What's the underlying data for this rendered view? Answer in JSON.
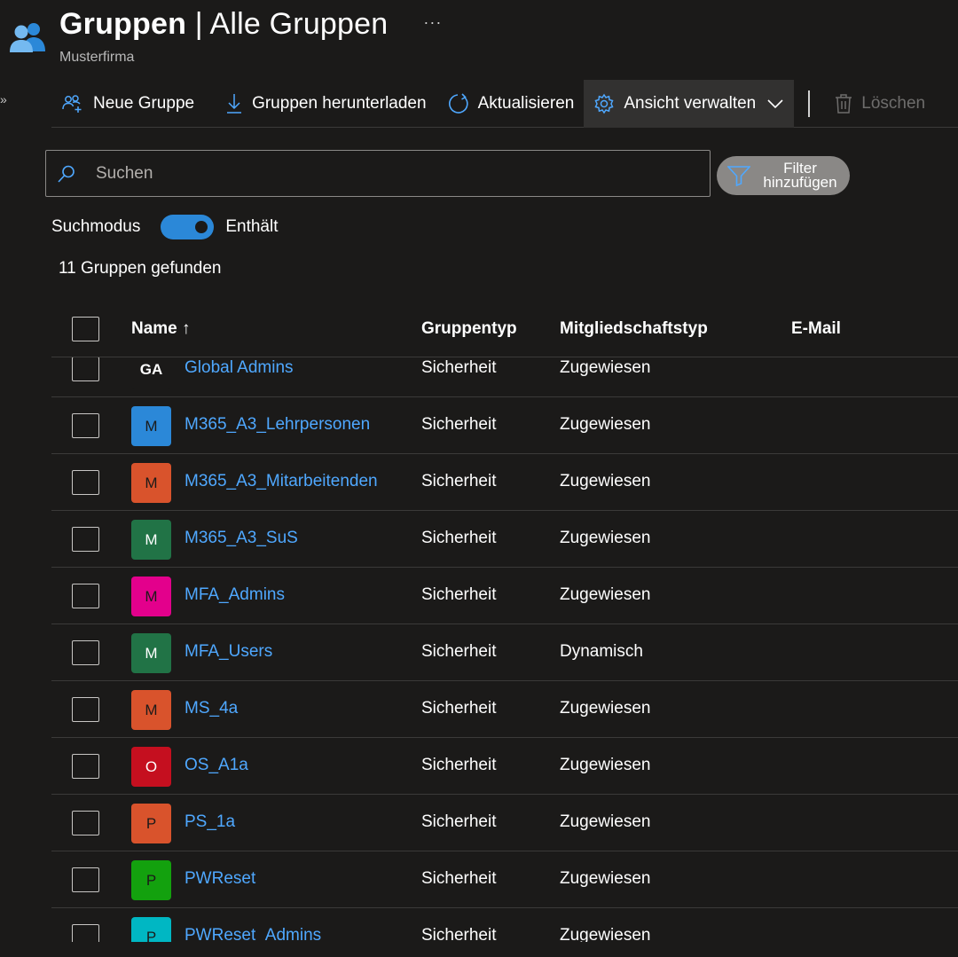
{
  "header": {
    "title_bold": "Gruppen",
    "title_rest": " | Alle Gruppen",
    "more": "···",
    "subtitle": "Musterfirma",
    "expand": "»"
  },
  "toolbar": {
    "new_group": "Neue Gruppe",
    "download": "Gruppen herunterladen",
    "refresh": "Aktualisieren",
    "manage_view": "Ansicht verwalten",
    "delete": "Löschen"
  },
  "search": {
    "placeholder": "Suchen",
    "value": ""
  },
  "filter": {
    "label": "Filter hinzufügen"
  },
  "search_mode": {
    "label": "Suchmodus",
    "value": "Enthält",
    "on": true
  },
  "result_count": "11 Gruppen gefunden",
  "table": {
    "columns": {
      "name": "Name ↑",
      "type": "Gruppentyp",
      "membership": "Mitgliedschaftstyp",
      "email": "E-Mail"
    },
    "rows": [
      {
        "initials": "GA",
        "color": "#1b1a19",
        "name": "Global Admins",
        "type": "Sicherheit",
        "membership": "Zugewiesen"
      },
      {
        "initials": "M",
        "color": "#2b88d8",
        "name": "M365_A3_Lehrpersonen",
        "type": "Sicherheit",
        "membership": "Zugewiesen"
      },
      {
        "initials": "M",
        "color": "#d9532c",
        "name": "M365_A3_Mitarbeitenden",
        "type": "Sicherheit",
        "membership": "Zugewiesen"
      },
      {
        "initials": "M",
        "color": "#217346",
        "name": "M365_A3_SuS",
        "type": "Sicherheit",
        "membership": "Zugewiesen"
      },
      {
        "initials": "M",
        "color": "#e3008c",
        "name": "MFA_Admins",
        "type": "Sicherheit",
        "membership": "Zugewiesen"
      },
      {
        "initials": "M",
        "color": "#217346",
        "name": "MFA_Users",
        "type": "Sicherheit",
        "membership": "Dynamisch"
      },
      {
        "initials": "M",
        "color": "#d9532c",
        "name": "MS_4a",
        "type": "Sicherheit",
        "membership": "Zugewiesen"
      },
      {
        "initials": "O",
        "color": "#c50f1f",
        "name": "OS_A1a",
        "type": "Sicherheit",
        "membership": "Zugewiesen"
      },
      {
        "initials": "P",
        "color": "#d9532c",
        "name": "PS_1a",
        "type": "Sicherheit",
        "membership": "Zugewiesen"
      },
      {
        "initials": "P",
        "color": "#13a10e",
        "name": "PWReset",
        "type": "Sicherheit",
        "membership": "Zugewiesen"
      },
      {
        "initials": "P",
        "color": "#00b7c3",
        "name": "PWReset_Admins",
        "type": "Sicherheit",
        "membership": "Zugewiesen"
      }
    ]
  }
}
